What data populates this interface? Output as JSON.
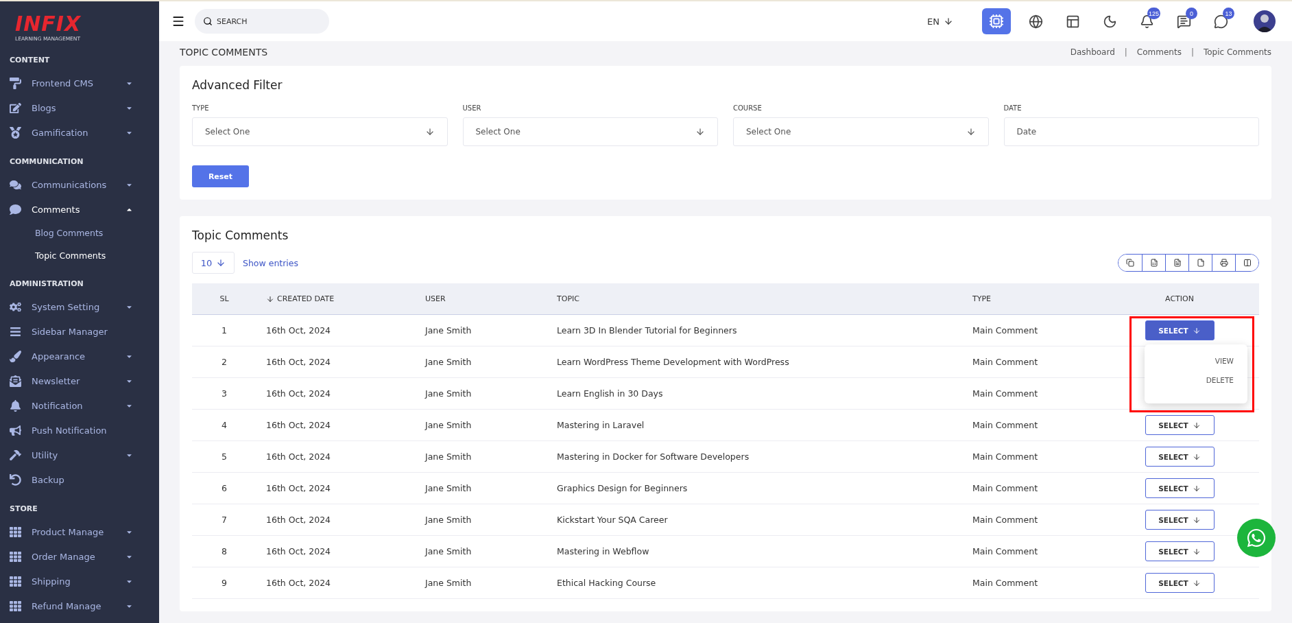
{
  "logo": {
    "name": "INFIX",
    "tagline": "LEARNING MANAGEMENT"
  },
  "sidebar": {
    "sections": [
      {
        "title": "CONTENT",
        "items": [
          {
            "label": "Frontend CMS",
            "expanded": false
          },
          {
            "label": "Blogs",
            "expanded": false
          },
          {
            "label": "Gamification",
            "expanded": false
          }
        ]
      },
      {
        "title": "COMMUNICATION",
        "items": [
          {
            "label": "Communications",
            "expanded": false
          },
          {
            "label": "Comments",
            "expanded": true,
            "children": [
              {
                "label": "Blog Comments",
                "selected": false
              },
              {
                "label": "Topic Comments",
                "selected": true
              }
            ]
          }
        ]
      },
      {
        "title": "ADMINISTRATION",
        "items": [
          {
            "label": "System Setting",
            "expanded": false
          },
          {
            "label": "Sidebar Manager"
          },
          {
            "label": "Appearance",
            "expanded": false
          },
          {
            "label": "Newsletter",
            "expanded": false
          },
          {
            "label": "Notification",
            "expanded": false
          },
          {
            "label": "Push Notification"
          },
          {
            "label": "Utility",
            "expanded": false
          },
          {
            "label": "Backup"
          }
        ]
      },
      {
        "title": "STORE",
        "items": [
          {
            "label": "Product Manage",
            "expanded": false
          },
          {
            "label": "Order Manage",
            "expanded": false
          },
          {
            "label": "Shipping",
            "expanded": false
          },
          {
            "label": "Refund Manage",
            "expanded": false
          }
        ]
      }
    ]
  },
  "header": {
    "search": {
      "placeholder": "SEARCH"
    },
    "language": "EN",
    "badges": {
      "notifications": "125",
      "messages": "0",
      "chats": "13"
    }
  },
  "page": {
    "title": "TOPIC COMMENTS",
    "breadcrumb": [
      "Dashboard",
      "Comments",
      "Topic Comments"
    ],
    "breadcrumb_separators": [
      "|",
      "|"
    ]
  },
  "filter": {
    "title": "Advanced Filter",
    "fields": [
      {
        "label": "TYPE",
        "placeholder": "Select One",
        "kind": "select"
      },
      {
        "label": "USER",
        "placeholder": "Select One",
        "kind": "select"
      },
      {
        "label": "COURSE",
        "placeholder": "Select One",
        "kind": "select"
      },
      {
        "label": "DATE",
        "placeholder": "Date",
        "kind": "date"
      }
    ],
    "reset": "Reset"
  },
  "table": {
    "title": "Topic Comments",
    "page_size": "10",
    "show_entries": "Show entries",
    "columns": [
      {
        "label": "SL",
        "sorted": false
      },
      {
        "label": "CREATED DATE",
        "sorted": true
      },
      {
        "label": "USER",
        "sorted": false
      },
      {
        "label": "TOPIC",
        "sorted": false
      },
      {
        "label": "TYPE",
        "sorted": false
      },
      {
        "label": "ACTION",
        "sorted": false
      }
    ],
    "menu_items": [
      "VIEW",
      "DELETE"
    ],
    "rows": [
      {
        "sl": "1",
        "date": "16th Oct, 2024",
        "user": "Jane Smith",
        "topic": "Learn 3D In Blender Tutorial for Beginners",
        "type": "Main Comment",
        "action": "SELECT",
        "menu_open": true
      },
      {
        "sl": "2",
        "date": "16th Oct, 2024",
        "user": "Jane Smith",
        "topic": "Learn WordPress Theme Development with WordPress",
        "type": "Main Comment"
      },
      {
        "sl": "3",
        "date": "16th Oct, 2024",
        "user": "Jane Smith",
        "topic": "Learn English in 30 Days",
        "type": "Main Comment"
      },
      {
        "sl": "4",
        "date": "16th Oct, 2024",
        "user": "Jane Smith",
        "topic": "Mastering in Laravel",
        "type": "Main Comment",
        "action": "SELECT",
        "menu_open": false
      },
      {
        "sl": "5",
        "date": "16th Oct, 2024",
        "user": "Jane Smith",
        "topic": "Mastering in Docker for Software Developers",
        "type": "Main Comment",
        "action": "SELECT",
        "menu_open": false
      },
      {
        "sl": "6",
        "date": "16th Oct, 2024",
        "user": "Jane Smith",
        "topic": "Graphics Design for Beginners",
        "type": "Main Comment",
        "action": "SELECT",
        "menu_open": false
      },
      {
        "sl": "7",
        "date": "16th Oct, 2024",
        "user": "Jane Smith",
        "topic": "Kickstart Your SQA Career",
        "type": "Main Comment",
        "action": "SELECT",
        "menu_open": false
      },
      {
        "sl": "8",
        "date": "16th Oct, 2024",
        "user": "Jane Smith",
        "topic": "Mastering in Webflow",
        "type": "Main Comment",
        "action": "SELECT",
        "menu_open": false
      },
      {
        "sl": "9",
        "date": "16th Oct, 2024",
        "user": "Jane Smith",
        "topic": "Ethical Hacking Course",
        "type": "Main Comment",
        "action": "SELECT",
        "menu_open": false
      }
    ]
  }
}
